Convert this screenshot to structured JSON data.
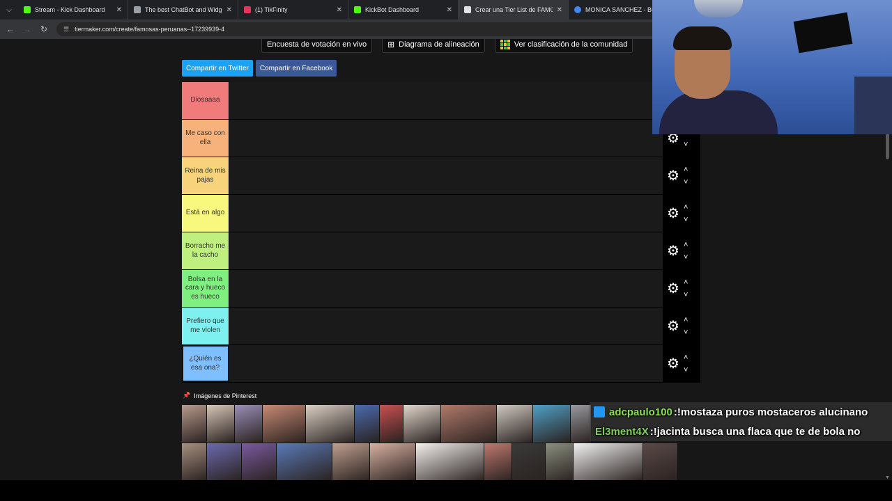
{
  "browser": {
    "tabs": [
      {
        "title": "Stream - Kick Dashboard",
        "favicon_color": "#53fc18",
        "active": false
      },
      {
        "title": "The best ChatBot and Widgets",
        "favicon_color": "#9aa0a6",
        "active": false
      },
      {
        "title": "(1) TikFinity",
        "favicon_color": "#e8345a",
        "active": false
      },
      {
        "title": "KickBot Dashboard",
        "favicon_color": "#53fc18",
        "active": false
      },
      {
        "title": "Crear una Tier List de FAMOSAS",
        "favicon_color": "#e3e3e3",
        "active": true
      },
      {
        "title": "MONICA SANCHEZ - Busca",
        "favicon_color": "#4285f4",
        "active": false
      }
    ],
    "url": "tiermaker.com/create/famosas-peruanas--17239939-4"
  },
  "top_buttons": [
    {
      "label": "Encuesta de votación en vivo",
      "icon": ""
    },
    {
      "label": "Diagrama de alineación",
      "icon": "alignment-grid-icon"
    },
    {
      "label": "Ver clasificación de la comunidad",
      "icon": "community-grid-icon"
    }
  ],
  "share": {
    "twitter_label": "Compartir en Twitter",
    "facebook_label": "Compartir en Facebook"
  },
  "tiers": [
    {
      "label": "Diosaaaa",
      "color": "#f07b7b"
    },
    {
      "label": "Me caso con ella",
      "color": "#f7b27b"
    },
    {
      "label": "Reina de mis pajas",
      "color": "#f7d47b"
    },
    {
      "label": "Está en algo",
      "color": "#f8f87f"
    },
    {
      "label": "Borracho me la cacho",
      "color": "#bff07f"
    },
    {
      "label": "Bolsa en la cara y hueco es hueco",
      "color": "#7ff07f"
    },
    {
      "label": "Prefiero que me violen",
      "color": "#7ff0f0"
    },
    {
      "label": "¿Quién es esa ona?",
      "color": "#7fbfff"
    }
  ],
  "pinterest": {
    "title": "Imágenes de Pinterest",
    "icon": "pushpin-icon"
  },
  "chat": [
    {
      "user": "adcpaulo100",
      "separator": ": ",
      "message": "!mostaza puros mostaceros alucinano",
      "user_color": "#8be04e"
    },
    {
      "user": "El3ment4X",
      "separator": ": ",
      "message": "!jacinta busca una flaca que te de bola no",
      "user_color": "#7fcf5a"
    }
  ]
}
